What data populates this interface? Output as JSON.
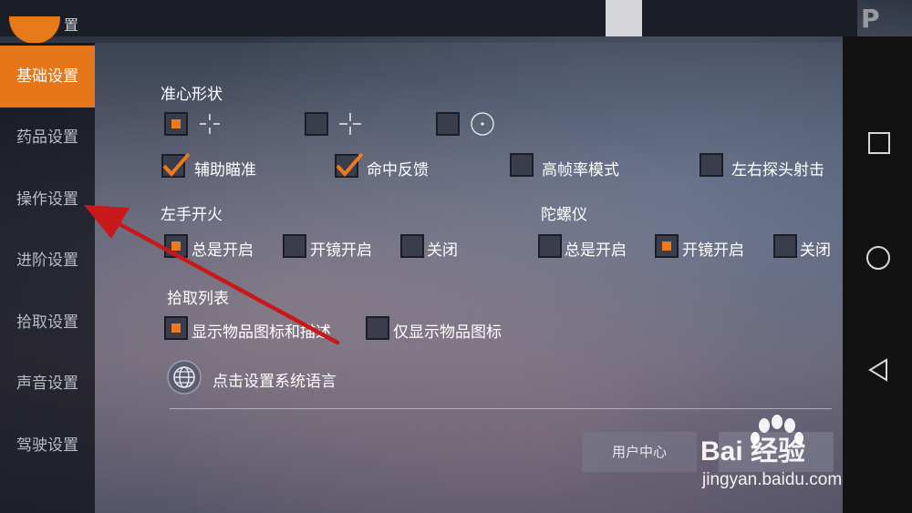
{
  "header": {
    "title_fragment": "置"
  },
  "sidebar": {
    "items": [
      {
        "label": "基础设置",
        "active": true
      },
      {
        "label": "药品设置"
      },
      {
        "label": "操作设置"
      },
      {
        "label": "进阶设置"
      },
      {
        "label": "拾取设置"
      },
      {
        "label": "声音设置"
      },
      {
        "label": "驾驶设置"
      }
    ]
  },
  "crosshair": {
    "title": "准心形状",
    "options": [
      {
        "checked": true,
        "icon": "crosshair-small-icon"
      },
      {
        "checked": false,
        "icon": "crosshair-large-icon"
      },
      {
        "checked": false,
        "icon": "crosshair-dot-icon"
      }
    ]
  },
  "toggles": [
    {
      "label": "辅助瞄准",
      "checked": true
    },
    {
      "label": "命中反馈",
      "checked": true
    },
    {
      "label": "高帧率模式",
      "checked": false
    },
    {
      "label": "左右探头射击",
      "checked": false
    }
  ],
  "left_fire": {
    "title": "左手开火",
    "options": [
      {
        "label": "总是开启",
        "checked": true
      },
      {
        "label": "开镜开启",
        "checked": false
      },
      {
        "label": "关闭",
        "checked": false
      }
    ]
  },
  "gyroscope": {
    "title": "陀螺仪",
    "options": [
      {
        "label": "总是开启",
        "checked": false
      },
      {
        "label": "开镜开启",
        "checked": true
      },
      {
        "label": "关闭",
        "checked": false
      }
    ]
  },
  "pickup_list": {
    "title": "拾取列表",
    "options": [
      {
        "label": "显示物品图标和描述",
        "checked": true
      },
      {
        "label": "仅显示物品图标",
        "checked": false
      }
    ]
  },
  "language": {
    "label": "点击设置系统语言",
    "icon": "globe-icon"
  },
  "buttons": {
    "user_center": "用户中心"
  },
  "watermark": {
    "brand": "Bai 经验",
    "url": "jingyan.baidu.com"
  },
  "colors": {
    "accent": "#e6761a",
    "panel_bg": "#3a3d4c"
  }
}
